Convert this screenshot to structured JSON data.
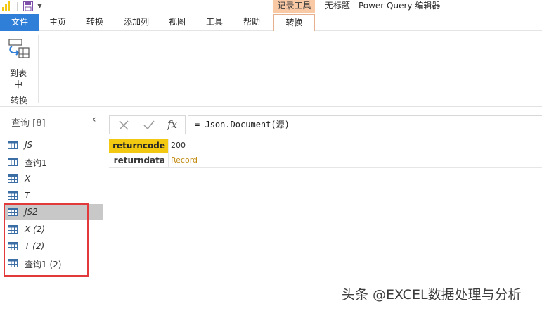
{
  "window": {
    "title": "无标题 - Power Query 编辑器",
    "context_tab_group": "记录工具"
  },
  "ribbon": {
    "tabs": [
      {
        "label": "文件"
      },
      {
        "label": "主页"
      },
      {
        "label": "转换"
      },
      {
        "label": "添加列"
      },
      {
        "label": "视图"
      },
      {
        "label": "工具"
      },
      {
        "label": "帮助"
      },
      {
        "label": "转换",
        "active": true
      }
    ],
    "to_table_label": "到表\n中",
    "to_table_line1": "到表",
    "to_table_line2": "中",
    "group_label": "转换"
  },
  "queries": {
    "title": "查询 [8]",
    "items": [
      {
        "label": "JS",
        "italic": true
      },
      {
        "label": "查询1",
        "italic": false
      },
      {
        "label": "X",
        "italic": true
      },
      {
        "label": "T",
        "italic": true
      },
      {
        "label": "JS2",
        "italic": true,
        "selected": true
      },
      {
        "label": "X (2)",
        "italic": true
      },
      {
        "label": "T (2)",
        "italic": true
      },
      {
        "label": "查询1 (2)",
        "italic": false
      }
    ]
  },
  "formula_bar": {
    "fx_label": "fx",
    "formula": "= Json.Document(源)"
  },
  "record": {
    "rows": [
      {
        "key": "returncode",
        "value": "200"
      },
      {
        "key": "returndata",
        "value": "Record"
      }
    ]
  },
  "watermark": "头条 @EXCEL数据处理与分析",
  "colors": {
    "file_tab": "#2f7fd8",
    "context_header": "#f9c8a5",
    "selected_key": "#f2c811",
    "record_link": "#c18b10",
    "highlight_box": "#e23a3a"
  }
}
